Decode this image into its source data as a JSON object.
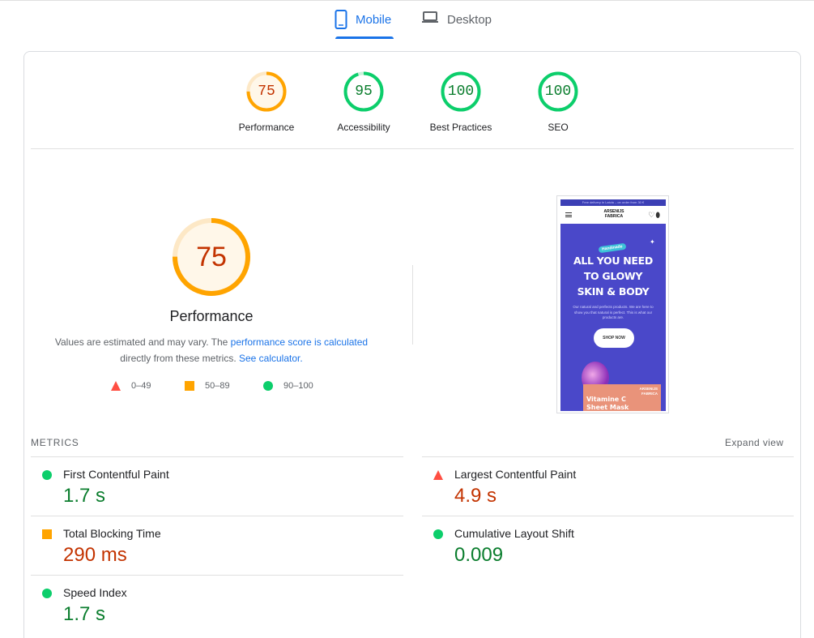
{
  "tabs": [
    {
      "label": "Mobile",
      "icon": "phone-icon",
      "selected": true
    },
    {
      "label": "Desktop",
      "icon": "laptop-icon",
      "selected": false
    }
  ],
  "colors": {
    "accent": "#1a73e8",
    "pass": "#0cce6b",
    "average": "#ffa400",
    "fail": "#ff4e42",
    "pass_text": "#0a7d2d",
    "fail_text": "#c33300"
  },
  "scores": [
    {
      "value": "75",
      "label": "Performance",
      "rating": "average"
    },
    {
      "value": "95",
      "label": "Accessibility",
      "rating": "pass"
    },
    {
      "value": "100",
      "label": "Best Practices",
      "rating": "pass"
    },
    {
      "value": "100",
      "label": "SEO",
      "rating": "pass"
    }
  ],
  "performance": {
    "score": "75",
    "title": "Performance",
    "desc_prefix": "Values are estimated and may vary. The ",
    "desc_link1": "performance score is calculated",
    "desc_middle": " directly from these metrics. ",
    "desc_link2": "See calculator.",
    "legend": [
      {
        "range": "0–49",
        "shape": "triangle"
      },
      {
        "range": "50–89",
        "shape": "square"
      },
      {
        "range": "90–100",
        "shape": "circle"
      }
    ]
  },
  "screenshot": {
    "banner": "Free delivery in Latvia – on order from 30 €",
    "brand_line1": "ARSENIJS",
    "brand_line2": "FABRICA",
    "stamp": "Handmade",
    "headline": [
      "ALL YOU NEED",
      "TO GLOWY",
      "SKIN & BODY"
    ],
    "subtext": "Our natural and perfects products. We are here to show you that natural is perfect. This is what our products are.",
    "button": "SHOP NOW",
    "product_line1": "Vitamine C",
    "product_line2": "Sheet Mask"
  },
  "metrics": {
    "title": "METRICS",
    "expand": "Expand view",
    "items": [
      {
        "name": "First Contentful Paint",
        "value": "1.7 s",
        "rating": "pass"
      },
      {
        "name": "Largest Contentful Paint",
        "value": "4.9 s",
        "rating": "fail"
      },
      {
        "name": "Total Blocking Time",
        "value": "290 ms",
        "rating": "average"
      },
      {
        "name": "Cumulative Layout Shift",
        "value": "0.009",
        "rating": "pass"
      },
      {
        "name": "Speed Index",
        "value": "1.7 s",
        "rating": "pass"
      }
    ]
  }
}
